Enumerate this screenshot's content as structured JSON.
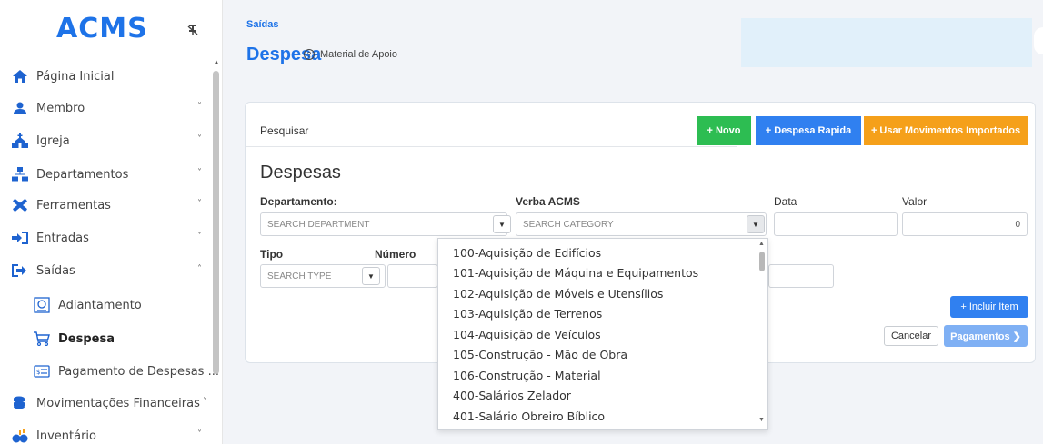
{
  "app": {
    "logo": "ACMS"
  },
  "sidebar": {
    "items": [
      {
        "label": "Página Inicial",
        "icon": "home-icon"
      },
      {
        "label": "Membro",
        "icon": "person-icon",
        "chevron": "˅"
      },
      {
        "label": "Igreja",
        "icon": "church-icon",
        "chevron": "˅"
      },
      {
        "label": "Departamentos",
        "icon": "sitemap-icon",
        "chevron": "˅"
      },
      {
        "label": "Ferramentas",
        "icon": "tools-icon",
        "chevron": "˅"
      },
      {
        "label": "Entradas",
        "icon": "sign-in-icon",
        "chevron": "˅"
      },
      {
        "label": "Saídas",
        "icon": "sign-out-icon",
        "chevron": "˄"
      },
      {
        "label": "Adiantamento",
        "icon": "receipt-icon"
      },
      {
        "label": "Despesa",
        "icon": "cart-icon"
      },
      {
        "label": "Pagamento de Despesas ...",
        "icon": "money-bill-icon"
      },
      {
        "label": "Movimentações Financeiras",
        "icon": "coins-icon",
        "chevron": "˅"
      },
      {
        "label": "Inventário",
        "icon": "inventory-icon",
        "chevron": "˅"
      }
    ]
  },
  "header": {
    "breadcrumb": "Saídas",
    "title": "Despesa",
    "help_label": "Material de Apoio"
  },
  "toolbar": {
    "search_tab": "Pesquisar",
    "novo": "+ Novo",
    "despesa_rapida": "+ Despesa Rapida",
    "usar_movimentos": "+ Usar Movimentos Importados"
  },
  "form": {
    "section_title": "Despesas",
    "departamento_label": "Departamento:",
    "departamento_placeholder": "SEARCH DEPARTMENT",
    "verba_label": "Verba ACMS",
    "verba_placeholder": "SEARCH CATEGORY",
    "data_label": "Data",
    "valor_label": "Valor",
    "valor_value": "0",
    "tipo_label": "Tipo",
    "tipo_placeholder": "SEARCH TYPE",
    "numero_label": "Número",
    "incluir_item": "+ Incluir Item",
    "cancelar": "Cancelar",
    "pagamentos": "Pagamentos ❯"
  },
  "dropdown": {
    "options": [
      "100-Aquisição de Edifícios",
      "101-Aquisição de Máquina e Equipamentos",
      "102-Aquisição de Móveis e Utensílios",
      "103-Aquisição de Terrenos",
      "104-Aquisição de Veículos",
      "105-Construção - Mão de Obra",
      "106-Construção - Material",
      "400-Salários Zelador",
      "401-Salário Obreiro Bíblico"
    ]
  },
  "colors": {
    "accent": "#1e73e8",
    "green": "#2dbd52",
    "orange": "#f5a01a"
  }
}
